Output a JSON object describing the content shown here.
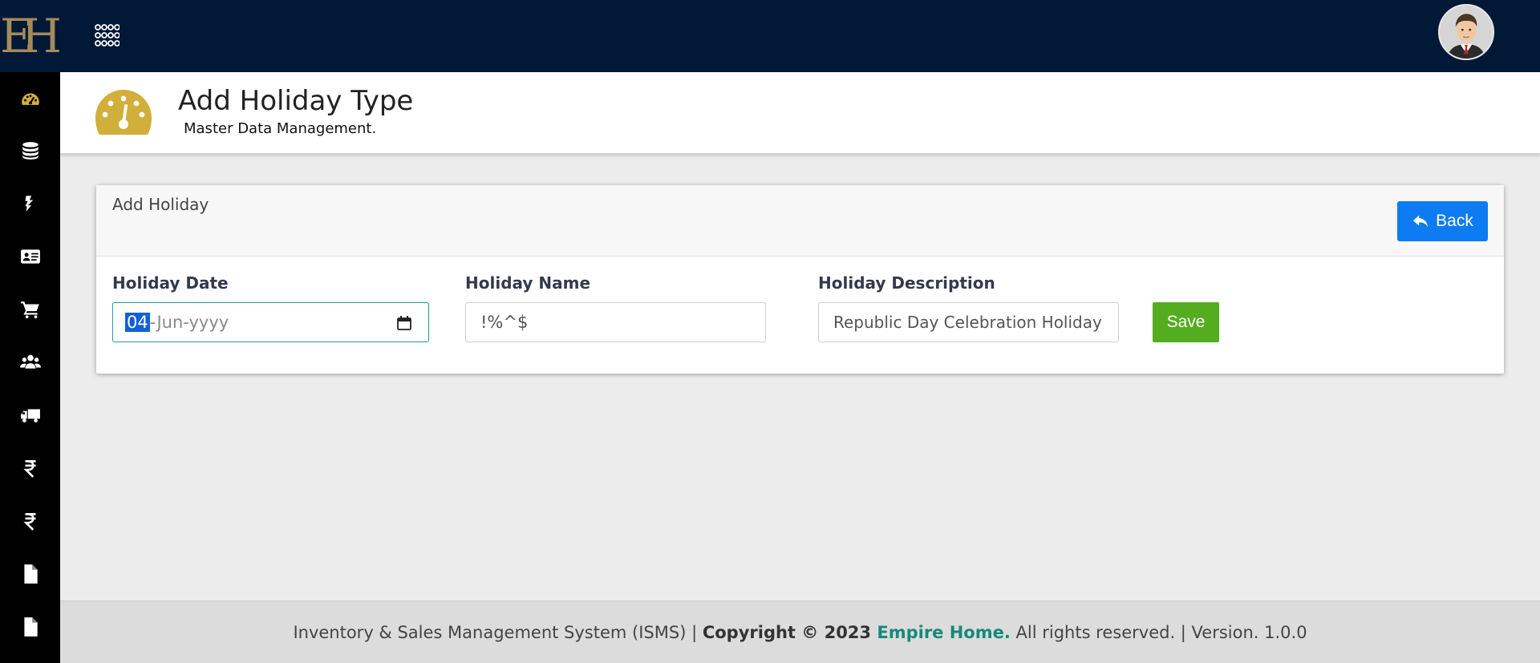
{
  "logo": {
    "text": "EH",
    "color": "#a58a5a"
  },
  "sidebar": {
    "icons": [
      "dashboard-icon",
      "database-icon",
      "bolt-icon",
      "id-card-icon",
      "cart-icon",
      "users-icon",
      "truck-icon",
      "rupee-icon",
      "rupee-icon",
      "file-icon",
      "file-icon"
    ]
  },
  "topbar": {
    "apps_icon": "grid-dots-icon",
    "avatar": "user-avatar"
  },
  "header": {
    "title": "Add Holiday Type",
    "subtitle": "Master Data Management."
  },
  "card": {
    "title": "Add Holiday",
    "back_label": "Back"
  },
  "form": {
    "date": {
      "label": "Holiday Date",
      "day": "04",
      "rest": "-Jun-yyyy"
    },
    "name": {
      "label": "Holiday Name",
      "value": "!%^$"
    },
    "description": {
      "label": "Holiday Description",
      "value": "Republic Day Celebration Holiday"
    },
    "save_label": "Save"
  },
  "footer": {
    "prefix": "Inventory & Sales Management System (ISMS) | ",
    "copyright": "Copyright © 2023 ",
    "brand": "Empire Home.",
    "suffix": " All rights reserved. | Version. 1.0.0"
  },
  "colors": {
    "topbar": "#011837",
    "sidebar": "#000000",
    "accent_gauge": "#d2ae3a",
    "back_button": "#0d7bf2",
    "save_button": "#53ad1e",
    "brand": "#168a7a"
  }
}
